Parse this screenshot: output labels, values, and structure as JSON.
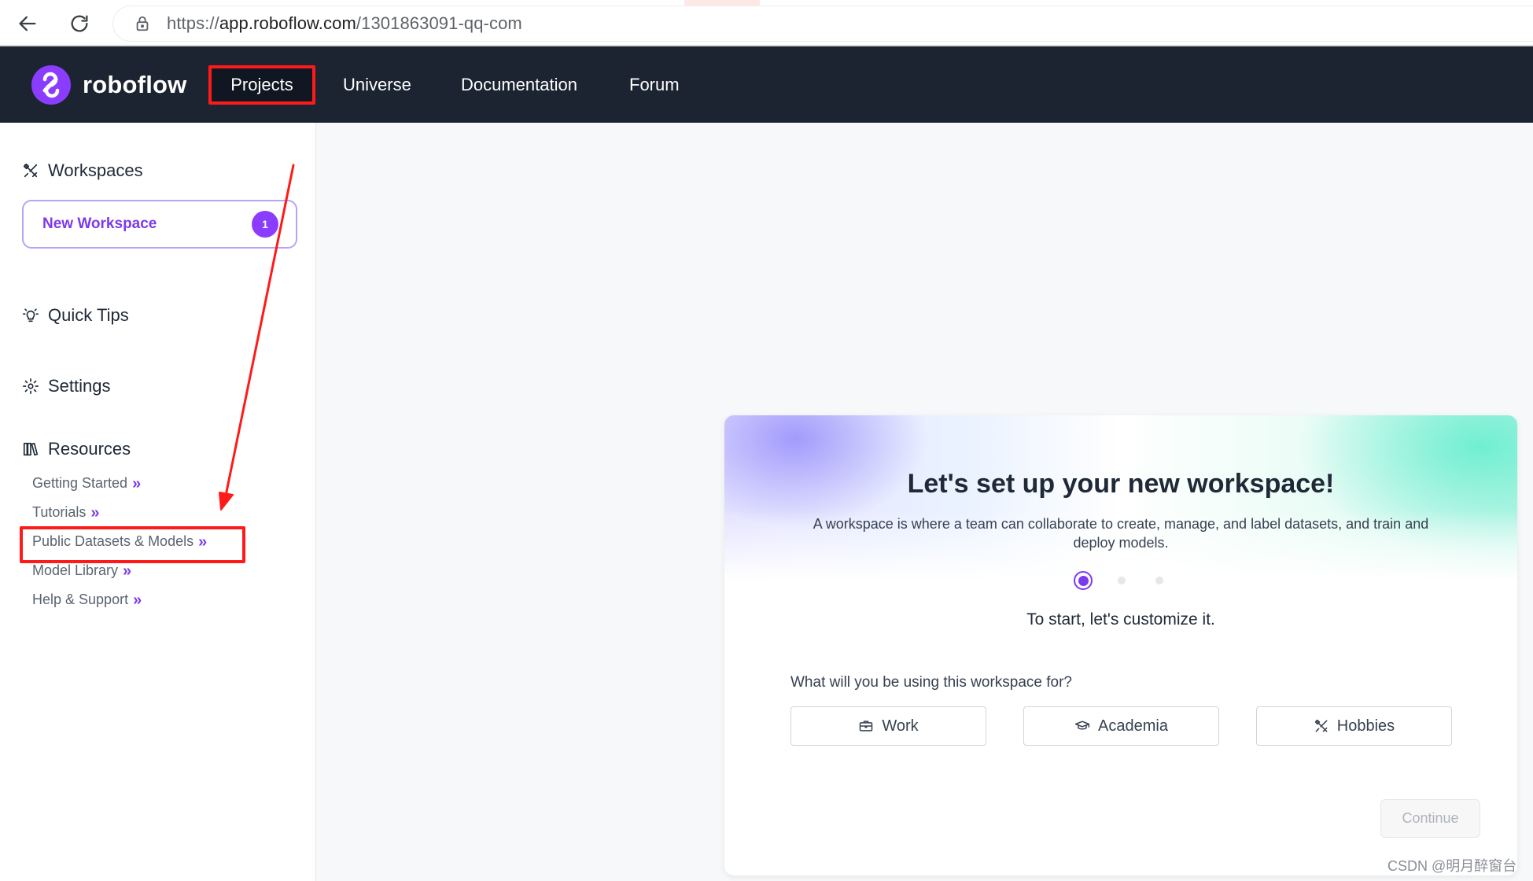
{
  "browser": {
    "url_prefix": "https://",
    "url_host": "app.roboflow.com",
    "url_path": "/1301863091-qq-com"
  },
  "topnav": {
    "logo_text": "roboflow",
    "items": [
      {
        "label": "Projects"
      },
      {
        "label": "Universe"
      },
      {
        "label": "Documentation"
      },
      {
        "label": "Forum"
      }
    ]
  },
  "sidebar": {
    "workspaces_title": "Workspaces",
    "new_workspace_label": "New Workspace",
    "new_workspace_badge": "1",
    "quick_tips": "Quick Tips",
    "settings": "Settings",
    "resources_title": "Resources",
    "resources": [
      {
        "label": "Getting Started"
      },
      {
        "label": "Tutorials"
      },
      {
        "label": "Public Datasets & Models"
      },
      {
        "label": "Model Library"
      },
      {
        "label": "Help & Support"
      }
    ],
    "chevron": "»"
  },
  "card": {
    "title": "Let's set up your new workspace!",
    "description": "A workspace is where a team can collaborate to create, manage, and label datasets, and train and deploy models.",
    "subtitle": "To start, let's customize it.",
    "question": "What will you be using this workspace for?",
    "options": [
      {
        "label": "Work",
        "icon": "briefcase-icon"
      },
      {
        "label": "Academia",
        "icon": "graduation-cap-icon"
      },
      {
        "label": "Hobbies",
        "icon": "tools-icon"
      }
    ],
    "step_current": 1,
    "step_total": 3,
    "continue_label": "Continue"
  },
  "watermark": "CSDN @明月醉窗台",
  "colors": {
    "nav_bg": "#1c2432",
    "accent": "#7c3aed",
    "annotation_red": "#ff1a1a"
  }
}
